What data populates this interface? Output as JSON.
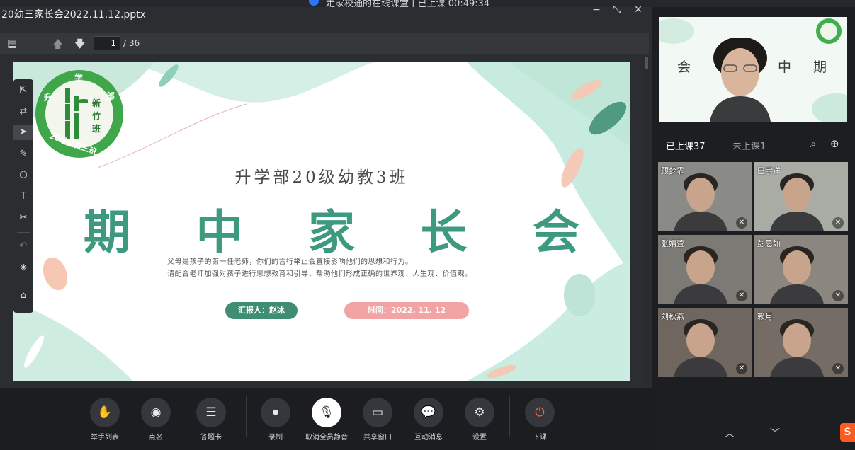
{
  "window": {
    "top_title": "走家校通的在线课堂 | 已上课 00:49:34",
    "file_title": "20幼三家长会2022.11.12.pptx",
    "minimize": "−",
    "restore": "⤡",
    "close": "✕"
  },
  "ppt_toolbar": {
    "sidebar_icon": "▤",
    "prev_icon": "🡅",
    "next_icon": "🡇",
    "current_page": "1",
    "total_pages": "/ 36"
  },
  "slide": {
    "logo_top": [
      "升",
      "学",
      "部"
    ],
    "logo_bottom": "20级幼教三班",
    "logo_center": [
      "新",
      "竹",
      "班"
    ],
    "subtitle": "升学部20级幼教3班",
    "title_chars": [
      "期",
      "中",
      "家",
      "长",
      "会"
    ],
    "line1": "父母是孩子的第一任老师，你们的言行举止会直接影响他们的思想和行为。",
    "line2": "请配合老师加强对孩子进行思想教育和引导，帮助他们形成正确的世界观、人生观、价值观。",
    "reporter": "汇报人：赵冰",
    "time": "时间：2022. 11. 12"
  },
  "annotation_tools": [
    "⇱",
    "⇄",
    "➤",
    "✎",
    "⬡",
    "T",
    "✂",
    "↶",
    "◈",
    "⌂"
  ],
  "bottom_toolbar": [
    {
      "label": "举手列表",
      "icon": "✋"
    },
    {
      "label": "点名",
      "icon": "◉"
    },
    {
      "label": "答题卡",
      "icon": "☰"
    },
    {
      "label": "录制",
      "icon": "⏺"
    },
    {
      "label": "取消全员静音",
      "icon": "🎙"
    },
    {
      "label": "共享窗口",
      "icon": "▭"
    },
    {
      "label": "互动消息",
      "icon": "💬"
    },
    {
      "label": "设置",
      "icon": "⚙"
    },
    {
      "label": "下课",
      "icon": "⏻"
    }
  ],
  "teacher_video": {
    "slide_chars": [
      "会",
      "中",
      "期"
    ]
  },
  "roster_tabs": {
    "attended": "已上课37",
    "absent": "未上课1",
    "search_icon": "⌕",
    "add_icon": "⊕"
  },
  "students": [
    {
      "name": "顾梦霏",
      "color": "#8a8a86"
    },
    {
      "name": "巴宇洋",
      "color": "#a8aca4"
    },
    {
      "name": "张婧萱",
      "color": "#7c7a74"
    },
    {
      "name": "彭思如",
      "color": "#8c8680"
    },
    {
      "name": "刘秋燕",
      "color": "#6f6660"
    },
    {
      "name": "赖月",
      "color": "#756d65"
    }
  ],
  "nav": {
    "up": "︿",
    "down": "﹀"
  },
  "ime_badge": "S",
  "colors": {
    "accent_green": "#3e9a7e",
    "pill_pink": "#f2a3a3",
    "end_orange": "#ff6a2a"
  }
}
